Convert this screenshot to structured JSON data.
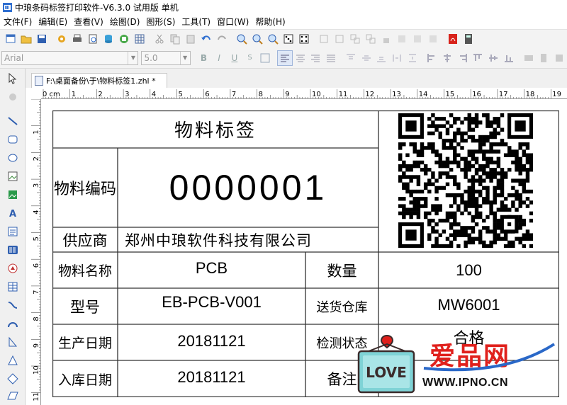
{
  "window": {
    "title": "中琅条码标签打印软件-V6.3.0 试用版 单机"
  },
  "menu": [
    "文件(F)",
    "编辑(E)",
    "查看(V)",
    "绘图(D)",
    "图形(S)",
    "工具(T)",
    "窗口(W)",
    "帮助(H)"
  ],
  "format_toolbar": {
    "font_name": "Arial",
    "font_size": "5.0"
  },
  "document": {
    "tab_label": "F:\\桌面备份\\于\\物料标签1.zhl *"
  },
  "ruler": {
    "unit_label": "0 cm",
    "top_ticks": [
      "1",
      "2",
      "3",
      "4",
      "5",
      "6",
      "7",
      "8",
      "9",
      "10",
      "11",
      "12",
      "13",
      "14",
      "15",
      "16",
      "17",
      "18",
      "19"
    ],
    "left_ticks": [
      "1",
      "2",
      "3",
      "4",
      "5",
      "6",
      "7",
      "8",
      "9",
      "10",
      "11"
    ]
  },
  "label": {
    "title": "物料标签",
    "code_label": "物料编码",
    "code_value": "0000001",
    "supplier_label": "供应商",
    "supplier_value": "郑州中琅软件科技有限公司",
    "name_label": "物料名称",
    "name_value": "PCB",
    "qty_label": "数量",
    "qty_value": "100",
    "model_label": "型号",
    "model_value": "EB-PCB-V001",
    "warehouse_label": "送货仓库",
    "warehouse_value": "MW6001",
    "prod_date_label": "生产日期",
    "prod_date_value": "20181121",
    "inspect_label": "检测状态",
    "inspect_value": "合格",
    "in_date_label": "入库日期",
    "in_date_value": "20181121",
    "remark_label": "备注"
  },
  "watermark": {
    "badge_text": "LOVE",
    "site_name": "爱品网",
    "site_url": "WWW.IPNO.CN"
  },
  "colors": {
    "watermark_red": "#e0201c",
    "badge_teal": "#7fd3d6",
    "badge_dark": "#3b2b2b",
    "ruler_line": "#999999"
  }
}
